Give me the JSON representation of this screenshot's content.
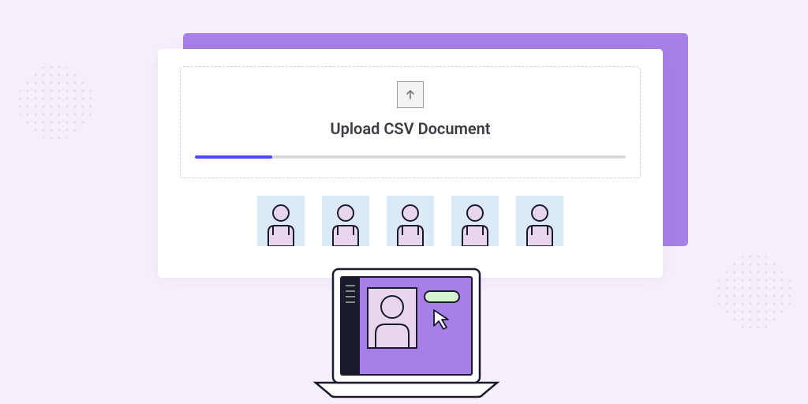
{
  "upload": {
    "title": "Upload CSV Document",
    "progress_percent": 18
  },
  "avatars": {
    "count": 5
  },
  "colors": {
    "background": "#f5effb",
    "accent_purple": "#a87ee8",
    "progress_blue": "#4a4aef",
    "tile_blue": "#dbe9f8",
    "person_fill": "#e8d5f0"
  }
}
